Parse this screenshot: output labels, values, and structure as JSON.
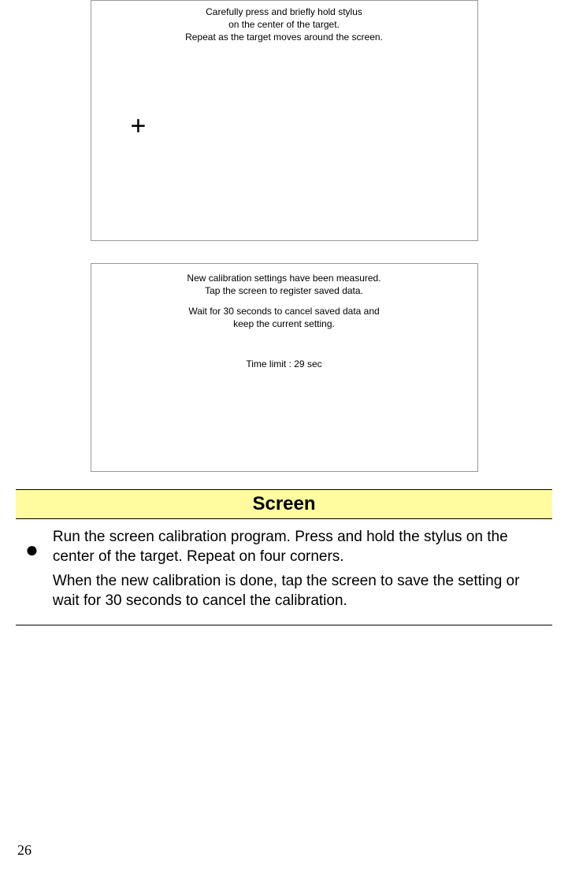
{
  "screenshot1": {
    "line1": "Carefully press and briefly hold stylus",
    "line2": "on the center of the target.",
    "line3": "Repeat as the target moves around the screen.",
    "crosshair": "+"
  },
  "screenshot2": {
    "line1": "New calibration settings have been measured.",
    "line2": "Tap the screen to register saved data.",
    "line3": "Wait for 30 seconds to cancel saved data and",
    "line4": "keep the current setting.",
    "timer": "Time limit : 29 sec"
  },
  "section": {
    "title": "Screen",
    "para1": "Run the screen calibration program. Press and hold the stylus on the center of the target. Repeat on four corners.",
    "para2": "When the new calibration is done, tap the screen to save the setting or wait for 30 seconds to cancel the calibration."
  },
  "page_number": "26"
}
